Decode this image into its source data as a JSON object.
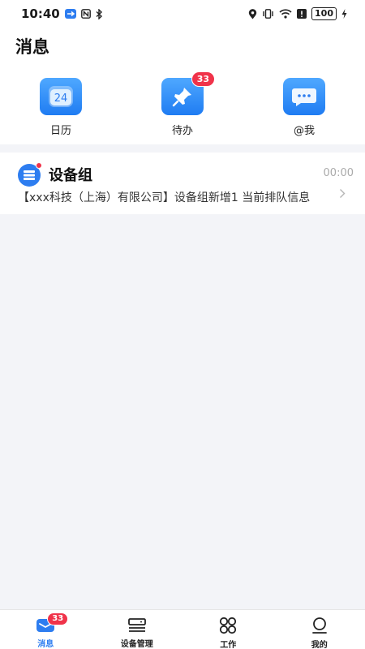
{
  "status_bar": {
    "time": "10:40",
    "battery": "100",
    "icons": [
      "app-notification-icon",
      "nfc-icon",
      "bluetooth-icon",
      "location-icon",
      "vibrate-icon",
      "wifi-icon",
      "alert-icon",
      "battery-icon",
      "charging-icon"
    ]
  },
  "header": {
    "title": "消息"
  },
  "quick_actions": [
    {
      "label": "日历",
      "icon": "calendar-icon",
      "icon_text": "24",
      "badge": ""
    },
    {
      "label": "待办",
      "icon": "todo-pin-icon",
      "badge": "33"
    },
    {
      "label": "@我",
      "icon": "mention-chat-icon",
      "badge": ""
    }
  ],
  "messages": [
    {
      "title": "设备组",
      "time": "00:00",
      "preview": "【xxx科技（上海）有限公司】设备组新增1 当前排队信息",
      "icon": "device-group-icon",
      "unread_dot": true
    }
  ],
  "tabbar": {
    "items": [
      {
        "label": "消息",
        "icon": "message-icon",
        "badge": "33",
        "active": true
      },
      {
        "label": "设备管理",
        "icon": "device-manage-icon",
        "badge": "",
        "active": false
      },
      {
        "label": "工作",
        "icon": "work-grid-icon",
        "badge": "",
        "active": false
      },
      {
        "label": "我的",
        "icon": "profile-icon",
        "badge": "",
        "active": false
      }
    ]
  },
  "colors": {
    "accent": "#2d7df0",
    "badge": "#f0334a",
    "background": "#f3f4f8"
  }
}
